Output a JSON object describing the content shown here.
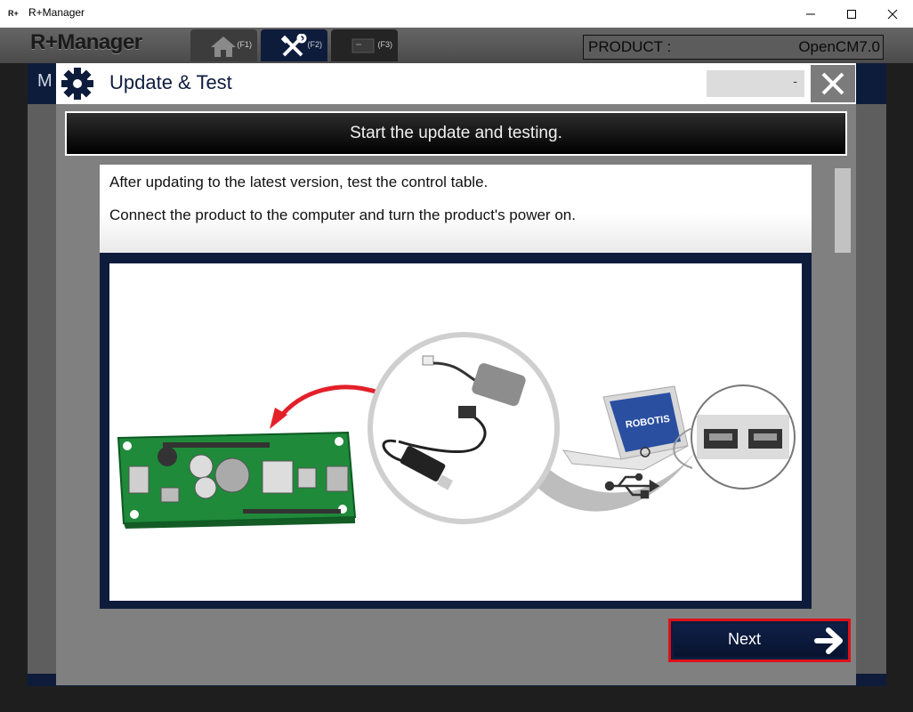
{
  "window": {
    "app_icon_text": "R+",
    "title": "R+Manager"
  },
  "app": {
    "logo": "R+Manager",
    "tabs": [
      {
        "key": "(F1)",
        "icon": "home-icon"
      },
      {
        "key": "(F2)",
        "icon": "tools-icon"
      },
      {
        "key": "(F3)",
        "icon": "monitor-icon"
      }
    ],
    "product_label": "PRODUCT :",
    "product_value": "OpenCM7.0",
    "behind_title": "M"
  },
  "dialog": {
    "title": "Update & Test",
    "version": "-",
    "banner": "Start the update and testing.",
    "instructions": [
      "After updating to the latest version, test the control table.",
      "Connect the product to the computer and turn the product's power on."
    ],
    "laptop_brand": "ROBOTIS",
    "next_label": "Next"
  },
  "colors": {
    "navy": "#0e1c3c",
    "highlight": "#e0101a",
    "board_green": "#1f8a3a",
    "arrow_red": "#e3202a"
  }
}
